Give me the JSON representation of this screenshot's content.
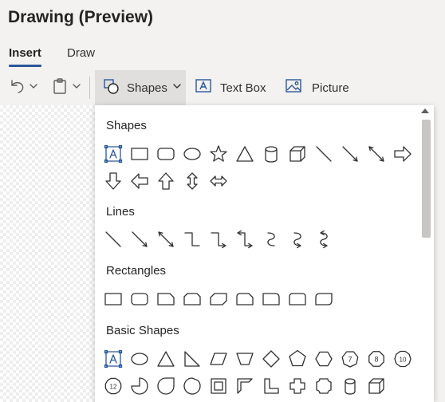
{
  "window": {
    "title": "Drawing (Preview)"
  },
  "tabs": [
    {
      "label": "Insert",
      "active": true
    },
    {
      "label": "Draw",
      "active": false
    }
  ],
  "toolbar": {
    "undo_icon": "undo-icon",
    "paste_icon": "clipboard-icon",
    "shapes_label": "Shapes",
    "textbox_label": "Text Box",
    "picture_label": "Picture"
  },
  "gallery": {
    "sections": [
      {
        "title": "Shapes",
        "rows": [
          [
            "textbox",
            "rectangle",
            "rounded-rectangle",
            "oval",
            "star",
            "triangle",
            "cylinder",
            "cube",
            "line",
            "arrow-line",
            "double-arrow-line",
            "right-arrow"
          ],
          [
            "down-arrow",
            "left-arrow",
            "up-arrow",
            "up-down-arrow",
            "left-right-arrow"
          ]
        ]
      },
      {
        "title": "Lines",
        "rows": [
          [
            "line",
            "arrow",
            "double-arrow",
            "elbow-connector",
            "elbow-arrow-connector",
            "elbow-double-arrow-connector",
            "curved-connector",
            "curved-arrow-connector",
            "curved-double-arrow-connector"
          ]
        ]
      },
      {
        "title": "Rectangles",
        "rows": [
          [
            "rectangle",
            "rounded-rectangle",
            "snip-single-corner",
            "snip-same-side",
            "snip-diagonal",
            "snip-round-single",
            "round-single-corner",
            "round-same-side",
            "round-diagonal"
          ]
        ]
      },
      {
        "title": "Basic Shapes",
        "rows": [
          [
            "textbox",
            "oval",
            "triangle",
            "right-triangle",
            "parallelogram",
            "trapezoid",
            "diamond",
            "pentagon",
            "hexagon",
            "heptagon",
            "octagon",
            "decagon"
          ],
          [
            "dodecagon",
            "pie",
            "teardrop",
            "chord",
            "frame",
            "half-frame",
            "l-shape",
            "plus",
            "plaque",
            "can",
            "cube"
          ]
        ]
      }
    ],
    "polygon_labels": {
      "heptagon": "7",
      "octagon": "8",
      "decagon": "10",
      "dodecagon": "12"
    }
  },
  "colors": {
    "accent": "#2b579a",
    "ribbon_bg": "#f3f2f1",
    "selected_btn": "#e1dfdd",
    "icon": "#323130"
  }
}
